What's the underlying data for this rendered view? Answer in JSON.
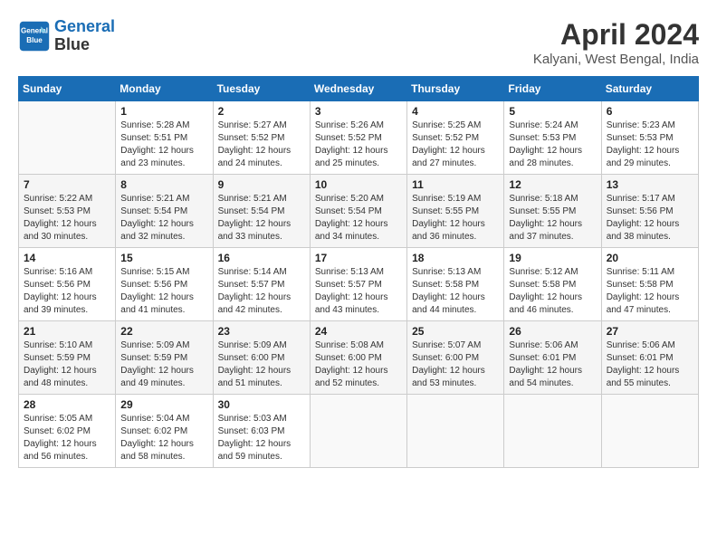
{
  "header": {
    "logo_line1": "General",
    "logo_line2": "Blue",
    "title": "April 2024",
    "location": "Kalyani, West Bengal, India"
  },
  "weekdays": [
    "Sunday",
    "Monday",
    "Tuesday",
    "Wednesday",
    "Thursday",
    "Friday",
    "Saturday"
  ],
  "weeks": [
    [
      {
        "day": "",
        "info": ""
      },
      {
        "day": "1",
        "info": "Sunrise: 5:28 AM\nSunset: 5:51 PM\nDaylight: 12 hours\nand 23 minutes."
      },
      {
        "day": "2",
        "info": "Sunrise: 5:27 AM\nSunset: 5:52 PM\nDaylight: 12 hours\nand 24 minutes."
      },
      {
        "day": "3",
        "info": "Sunrise: 5:26 AM\nSunset: 5:52 PM\nDaylight: 12 hours\nand 25 minutes."
      },
      {
        "day": "4",
        "info": "Sunrise: 5:25 AM\nSunset: 5:52 PM\nDaylight: 12 hours\nand 27 minutes."
      },
      {
        "day": "5",
        "info": "Sunrise: 5:24 AM\nSunset: 5:53 PM\nDaylight: 12 hours\nand 28 minutes."
      },
      {
        "day": "6",
        "info": "Sunrise: 5:23 AM\nSunset: 5:53 PM\nDaylight: 12 hours\nand 29 minutes."
      }
    ],
    [
      {
        "day": "7",
        "info": "Sunrise: 5:22 AM\nSunset: 5:53 PM\nDaylight: 12 hours\nand 30 minutes."
      },
      {
        "day": "8",
        "info": "Sunrise: 5:21 AM\nSunset: 5:54 PM\nDaylight: 12 hours\nand 32 minutes."
      },
      {
        "day": "9",
        "info": "Sunrise: 5:21 AM\nSunset: 5:54 PM\nDaylight: 12 hours\nand 33 minutes."
      },
      {
        "day": "10",
        "info": "Sunrise: 5:20 AM\nSunset: 5:54 PM\nDaylight: 12 hours\nand 34 minutes."
      },
      {
        "day": "11",
        "info": "Sunrise: 5:19 AM\nSunset: 5:55 PM\nDaylight: 12 hours\nand 36 minutes."
      },
      {
        "day": "12",
        "info": "Sunrise: 5:18 AM\nSunset: 5:55 PM\nDaylight: 12 hours\nand 37 minutes."
      },
      {
        "day": "13",
        "info": "Sunrise: 5:17 AM\nSunset: 5:56 PM\nDaylight: 12 hours\nand 38 minutes."
      }
    ],
    [
      {
        "day": "14",
        "info": "Sunrise: 5:16 AM\nSunset: 5:56 PM\nDaylight: 12 hours\nand 39 minutes."
      },
      {
        "day": "15",
        "info": "Sunrise: 5:15 AM\nSunset: 5:56 PM\nDaylight: 12 hours\nand 41 minutes."
      },
      {
        "day": "16",
        "info": "Sunrise: 5:14 AM\nSunset: 5:57 PM\nDaylight: 12 hours\nand 42 minutes."
      },
      {
        "day": "17",
        "info": "Sunrise: 5:13 AM\nSunset: 5:57 PM\nDaylight: 12 hours\nand 43 minutes."
      },
      {
        "day": "18",
        "info": "Sunrise: 5:13 AM\nSunset: 5:58 PM\nDaylight: 12 hours\nand 44 minutes."
      },
      {
        "day": "19",
        "info": "Sunrise: 5:12 AM\nSunset: 5:58 PM\nDaylight: 12 hours\nand 46 minutes."
      },
      {
        "day": "20",
        "info": "Sunrise: 5:11 AM\nSunset: 5:58 PM\nDaylight: 12 hours\nand 47 minutes."
      }
    ],
    [
      {
        "day": "21",
        "info": "Sunrise: 5:10 AM\nSunset: 5:59 PM\nDaylight: 12 hours\nand 48 minutes."
      },
      {
        "day": "22",
        "info": "Sunrise: 5:09 AM\nSunset: 5:59 PM\nDaylight: 12 hours\nand 49 minutes."
      },
      {
        "day": "23",
        "info": "Sunrise: 5:09 AM\nSunset: 6:00 PM\nDaylight: 12 hours\nand 51 minutes."
      },
      {
        "day": "24",
        "info": "Sunrise: 5:08 AM\nSunset: 6:00 PM\nDaylight: 12 hours\nand 52 minutes."
      },
      {
        "day": "25",
        "info": "Sunrise: 5:07 AM\nSunset: 6:00 PM\nDaylight: 12 hours\nand 53 minutes."
      },
      {
        "day": "26",
        "info": "Sunrise: 5:06 AM\nSunset: 6:01 PM\nDaylight: 12 hours\nand 54 minutes."
      },
      {
        "day": "27",
        "info": "Sunrise: 5:06 AM\nSunset: 6:01 PM\nDaylight: 12 hours\nand 55 minutes."
      }
    ],
    [
      {
        "day": "28",
        "info": "Sunrise: 5:05 AM\nSunset: 6:02 PM\nDaylight: 12 hours\nand 56 minutes."
      },
      {
        "day": "29",
        "info": "Sunrise: 5:04 AM\nSunset: 6:02 PM\nDaylight: 12 hours\nand 58 minutes."
      },
      {
        "day": "30",
        "info": "Sunrise: 5:03 AM\nSunset: 6:03 PM\nDaylight: 12 hours\nand 59 minutes."
      },
      {
        "day": "",
        "info": ""
      },
      {
        "day": "",
        "info": ""
      },
      {
        "day": "",
        "info": ""
      },
      {
        "day": "",
        "info": ""
      }
    ]
  ]
}
